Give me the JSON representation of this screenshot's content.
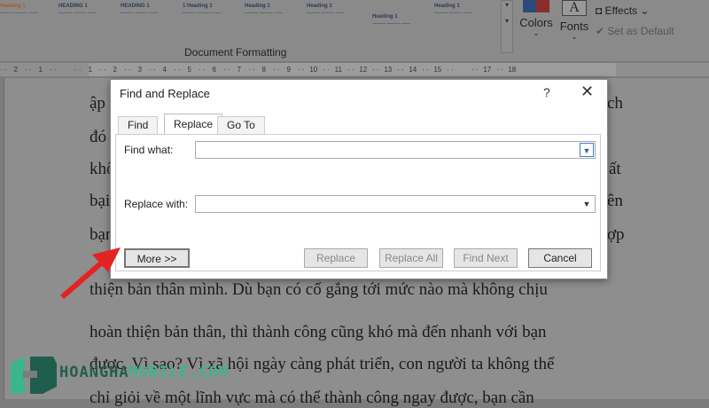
{
  "ribbon": {
    "styles": [
      {
        "heading": "Heading 1"
      },
      {
        "heading": "HEADING 1"
      },
      {
        "heading": "HEADING 1"
      },
      {
        "heading": "1 Heading 1"
      },
      {
        "heading": "Heading 1"
      },
      {
        "heading": "Heading 1"
      },
      {
        "heading": "Heading 1"
      },
      {
        "heading": "Heading 1"
      }
    ],
    "colors_label": "Colors",
    "fonts_label": "Fonts",
    "fonts_glyph": "A",
    "effects_label": "Effects",
    "set_default_label": "Set as Default",
    "group_label": "Document Formatting"
  },
  "ruler": {
    "ticks": [
      "2",
      "1",
      "",
      "1",
      "2",
      "3",
      "4",
      "5",
      "6",
      "7",
      "8",
      "9",
      "10",
      "11",
      "12",
      "13",
      "14",
      "15",
      "",
      "17",
      "18"
    ]
  },
  "document": {
    "lines": [
      {
        "left": "ập",
        "right": "ch"
      },
      {
        "left": "đó",
        "right": ""
      },
      {
        "left": "khô",
        "right": "ất"
      },
      {
        "left": "bại",
        "right": "ên"
      },
      {
        "left": "bạn",
        "right": "ợp"
      }
    ],
    "paragraph": [
      "thiện bản thân mình. Dù bạn có cố gắng tới mức nào mà không chịu",
      "hoàn thiện bản thân, thì thành công cũng khó mà đến nhanh với bạn",
      "được. Vì sao? Vì xã hội ngày càng phát triển, con người ta không thể",
      "chỉ giỏi về một lĩnh vực mà có thể thành công ngay được, bạn cần"
    ]
  },
  "dialog": {
    "title": "Find and Replace",
    "help": "?",
    "close": "✕",
    "tabs": [
      "Find",
      "Replace",
      "Go To"
    ],
    "find_label": "Find what:",
    "find_value": "",
    "replace_label": "Replace with:",
    "replace_value": "",
    "buttons": {
      "more": "More >>",
      "replace": "Replace",
      "replace_all": "Replace All",
      "find_next": "Find Next",
      "cancel": "Cancel"
    }
  },
  "watermark": {
    "part1": "HOANGHA",
    "part2": "MOBILE.COM"
  },
  "colors": {
    "highlight": "#d21f1f",
    "brand_dark": "#1f5e4c",
    "brand_light": "#3bb58a"
  }
}
